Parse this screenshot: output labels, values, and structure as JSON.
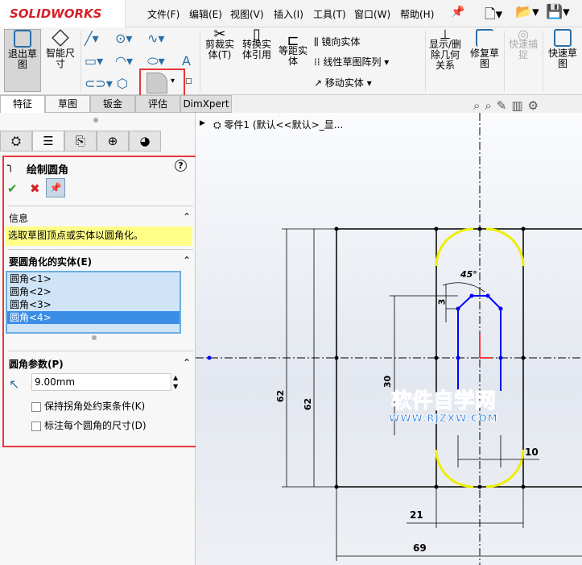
{
  "app": {
    "logo": "SOLIDWORKS"
  },
  "menu": [
    "文件(F)",
    "编辑(E)",
    "视图(V)",
    "插入(I)",
    "工具(T)",
    "窗口(W)",
    "帮助(H)"
  ],
  "ribbon": {
    "exit_sketch": "退出草图",
    "smart_dim": "智能尺寸",
    "trim": "剪裁实体(T)",
    "convert": "转换实体引用",
    "offset": "等距实体",
    "mirror": "镜向实体",
    "linear_pattern": "线性草图阵列",
    "move": "移动实体",
    "show_delete": "显示/删除几何关系",
    "repair": "修复草图",
    "quick_snap": "快速捕捉",
    "rapid_sketch": "快速草图"
  },
  "tabs": [
    "特征",
    "草图",
    "钣金",
    "评估",
    "DimXpert"
  ],
  "tree": {
    "item": "零件1 (默认<<默认>_显..."
  },
  "pm": {
    "title": "绘制圆角",
    "info_header": "信息",
    "info_text": "选取草图顶点或实体以圆角化。",
    "entities_header": "要圆角化的实体(E)",
    "entities": [
      "圆角<1>",
      "圆角<2>",
      "圆角<3>",
      "圆角<4>"
    ],
    "selected_index": 3,
    "params_header": "圆角参数(P)",
    "radius_value": "9.00mm",
    "keep_constraints": "保持拐角处约束条件(K)",
    "dimension_each": "标注每个圆角的尺寸(D)",
    "keep_constraints_checked": false,
    "dimension_each_checked": false
  },
  "drawing": {
    "dims": {
      "d62a": "62",
      "d62b": "62",
      "d30": "30",
      "d3": "3",
      "d45": "45°",
      "d10": "10",
      "d21": "21",
      "d69": "69"
    },
    "watermark": "软件自学网",
    "watermark_url": "WWW.RJZXW.COM"
  },
  "colors": {
    "highlight": "#e8363a",
    "sketch": "#0000ff",
    "fillet": "#ffff00",
    "info_bg": "#ffff88"
  }
}
